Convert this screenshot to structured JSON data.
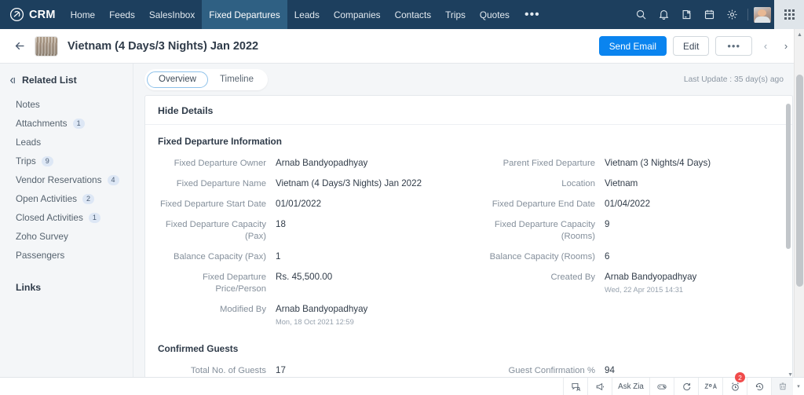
{
  "topnav": {
    "brand": "CRM",
    "brand_icon": "zoho-crm-logo-icon",
    "items": [
      {
        "label": "Home",
        "active": false
      },
      {
        "label": "Feeds",
        "active": false
      },
      {
        "label": "SalesInbox",
        "active": false
      },
      {
        "label": "Fixed Departures",
        "active": true
      },
      {
        "label": "Leads",
        "active": false
      },
      {
        "label": "Companies",
        "active": false
      },
      {
        "label": "Contacts",
        "active": false
      },
      {
        "label": "Trips",
        "active": false
      },
      {
        "label": "Quotes",
        "active": false
      }
    ],
    "more_label": "•••",
    "icons": [
      {
        "name": "search-icon"
      },
      {
        "name": "bell-notification-icon"
      },
      {
        "name": "add-note-icon"
      },
      {
        "name": "calendar-icon"
      },
      {
        "name": "gear-settings-icon"
      }
    ],
    "avatar_name": "user-avatar",
    "grid_name": "app-switcher-grid-icon"
  },
  "record_header": {
    "back_label": "←",
    "thumb_name": "record-thumbnail",
    "title": "Vietnam (4 Days/3 Nights) Jan 2022",
    "send_email_label": "Send Email",
    "edit_label": "Edit",
    "more_label": "•••",
    "prev_label": "‹",
    "next_label": "›"
  },
  "sidebar": {
    "related_list_title": "Related List",
    "items": [
      {
        "label": "Notes",
        "count": ""
      },
      {
        "label": "Attachments",
        "count": "1"
      },
      {
        "label": "Leads",
        "count": ""
      },
      {
        "label": "Trips",
        "count": "9"
      },
      {
        "label": "Vendor Reservations",
        "count": "4"
      },
      {
        "label": "Open Activities",
        "count": "2"
      },
      {
        "label": "Closed Activities",
        "count": "1"
      },
      {
        "label": "Zoho Survey",
        "count": ""
      },
      {
        "label": "Passengers",
        "count": ""
      }
    ],
    "links_title": "Links"
  },
  "main": {
    "tabs": [
      {
        "label": "Overview",
        "active": true
      },
      {
        "label": "Timeline",
        "active": false
      }
    ],
    "last_update": "Last Update : 35 day(s) ago",
    "hide_details_label": "Hide Details",
    "section_fixed_departure": "Fixed Departure Information",
    "section_confirmed_guests": "Confirmed Guests",
    "fields_left": [
      {
        "label": "Fixed Departure Owner",
        "value": "Arnab Bandyopadhyay",
        "sub": ""
      },
      {
        "label": "Fixed Departure Name",
        "value": "Vietnam (4 Days/3 Nights) Jan 2022",
        "sub": ""
      },
      {
        "label": "Fixed Departure Start Date",
        "value": "01/01/2022",
        "sub": ""
      },
      {
        "label": "Fixed Departure Capacity (Pax)",
        "value": "18",
        "sub": ""
      },
      {
        "label": "Balance Capacity (Pax)",
        "value": "1",
        "sub": ""
      },
      {
        "label": "Fixed Departure Price/Person",
        "value": "Rs. 45,500.00",
        "sub": ""
      },
      {
        "label": "Modified By",
        "value": "Arnab Bandyopadhyay",
        "sub": "Mon, 18 Oct 2021 12:59"
      }
    ],
    "fields_right": [
      {
        "label": "Parent Fixed Departure",
        "value": "Vietnam (3 Nights/4 Days)",
        "sub": ""
      },
      {
        "label": "Location",
        "value": "Vietnam",
        "sub": ""
      },
      {
        "label": "Fixed Departure End Date",
        "value": "01/04/2022",
        "sub": ""
      },
      {
        "label": "Fixed Departure Capacity (Rooms)",
        "value": "9",
        "sub": ""
      },
      {
        "label": "Balance Capacity (Rooms)",
        "value": "6",
        "sub": ""
      },
      {
        "label": "Created By",
        "value": "Arnab Bandyopadhyay",
        "sub": "Wed, 22 Apr 2015 14:31"
      }
    ],
    "guests_left": [
      {
        "label": "Total No. of Guests",
        "value": "17",
        "sub": ""
      }
    ],
    "guests_right": [
      {
        "label": "Guest Confirmation %",
        "value": "94",
        "sub": ""
      }
    ]
  },
  "bottombar": {
    "items": [
      {
        "name": "chat-support-icon",
        "label": ""
      },
      {
        "name": "megaphone-announcement-icon",
        "label": ""
      },
      {
        "name": "ask-zia-button",
        "label": "Ask Zia"
      },
      {
        "name": "gamification-icon",
        "label": ""
      },
      {
        "name": "refresh-rotate-icon",
        "label": ""
      },
      {
        "name": "zia-voice-icon",
        "label": ""
      },
      {
        "name": "reminder-alarm-icon",
        "label": "",
        "badge": "2"
      },
      {
        "name": "recent-history-icon",
        "label": ""
      },
      {
        "name": "recycle-bin-icon",
        "label": ""
      }
    ],
    "caret_label": "▾"
  },
  "colors": {
    "nav_bg": "#1d3f5e",
    "nav_active": "#2f6083",
    "primary_button": "#0a84ef",
    "badge_bg": "#dde7f5",
    "alert_red": "#f04b4b",
    "page_bg": "#f4f6f8"
  }
}
